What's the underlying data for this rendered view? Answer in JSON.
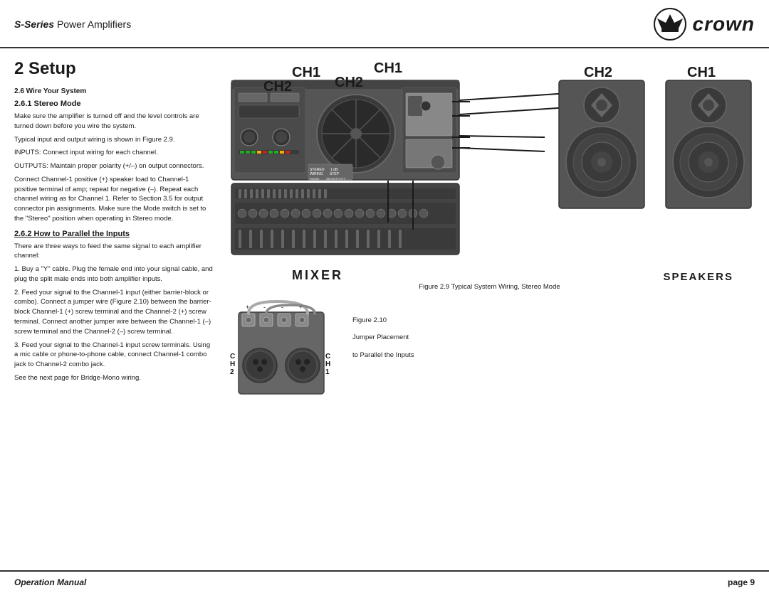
{
  "header": {
    "series_text": "S-Series",
    "subtitle": "Power Amplifiers",
    "brand": "crown"
  },
  "page": {
    "section_number": "2",
    "section_title": "Setup",
    "page_number": "page 9"
  },
  "left_column": {
    "wire_section_label": "2.6  Wire Your System",
    "stereo_heading": "2.6.1  Stereo Mode",
    "stereo_p1": "Make sure the amplifier is turned off and the level controls are turned down before you wire the system.",
    "stereo_p2": "Typical input and output wiring is shown in Figure 2.9.",
    "stereo_p3": "INPUTS: Connect input wiring for each channel.",
    "stereo_p4": "OUTPUTS: Maintain proper polarity (+/–) on output connectors.",
    "stereo_p5": "Connect Channel-1 positive (+) speaker load to Channel-1 positive terminal of amp; repeat for negative (–). Repeat each channel wiring as for Channel 1. Refer to Section 3.5 for output connector pin assignments. Make sure the Mode switch is set to the \"Stereo\" position when operating in Stereo mode.",
    "parallel_heading": "2.6.2  How to Parallel the Inputs",
    "parallel_p1": "There are three ways to feed the same signal to each amplifier channel:",
    "parallel_p2": "1.  Buy a \"Y\" cable. Plug the female end into your signal cable, and plug the split male ends into both amplifier inputs.",
    "parallel_p3": "2.  Feed your signal to the Channel-1 input (either barrier-block or combo). Connect a jumper wire (Figure 2.10) between the barrier-block Channel-1 (+) screw terminal and the Channel-2 (+) screw terminal. Connect another jumper wire between the Channel-1 (–) screw terminal and the Channel-2 (–) screw terminal.",
    "parallel_p4": "3.  Feed your signal to the Channel-1 input screw terminals. Using a mic cable or phone-to-phone cable, connect Channel-1 combo jack to Channel-2 combo jack.",
    "parallel_p5": "See the next page for Bridge-Mono wiring."
  },
  "footer": {
    "left_text": "Operation Manual",
    "right_text": "page 9"
  },
  "diagrams": {
    "ch1_label_left": "CH1",
    "ch2_label": "CH2",
    "ch1_label_right": "CH1",
    "mixer_label": "MIXER",
    "speakers_label": "SPEAKERS",
    "figure_29_caption": "Figure 2.9 Typical System Wiring, Stereo Mode",
    "figure_210_caption": "Figure 2.10",
    "figure_210_line2": "Jumper Placement",
    "figure_210_line3": "to Parallel the Inputs"
  }
}
